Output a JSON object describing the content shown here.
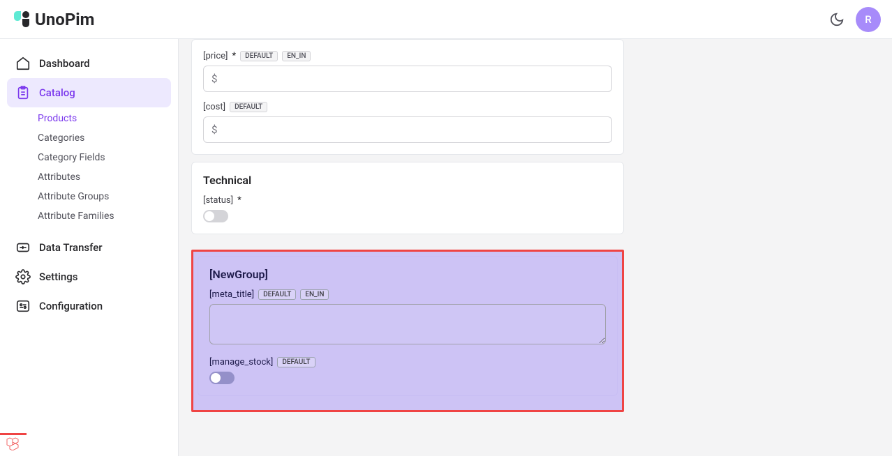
{
  "header": {
    "brand": "UnoPim",
    "avatar_initial": "R"
  },
  "sidebar": {
    "items": [
      {
        "label": "Dashboard",
        "active": false,
        "icon": "home"
      },
      {
        "label": "Catalog",
        "active": true,
        "icon": "clipboard"
      },
      {
        "label": "Data Transfer",
        "active": false,
        "icon": "transfer"
      },
      {
        "label": "Settings",
        "active": false,
        "icon": "gear"
      },
      {
        "label": "Configuration",
        "active": false,
        "icon": "config"
      }
    ],
    "catalog_sub": [
      {
        "label": "Products",
        "active": true
      },
      {
        "label": "Categories",
        "active": false
      },
      {
        "label": "Category Fields",
        "active": false
      },
      {
        "label": "Attributes",
        "active": false
      },
      {
        "label": "Attribute Groups",
        "active": false
      },
      {
        "label": "Attribute Families",
        "active": false
      }
    ]
  },
  "badges": {
    "default": "DEFAULT",
    "locale": "EN_IN"
  },
  "symbols": {
    "currency": "$",
    "required": "*"
  },
  "groups": {
    "pricing": {
      "price_label": "[price]",
      "cost_label": "[cost]"
    },
    "technical": {
      "title": "Technical",
      "status_label": "[status]"
    },
    "newgroup": {
      "title": "[NewGroup]",
      "meta_title_label": "[meta_title]",
      "manage_stock_label": "[manage_stock]"
    }
  }
}
